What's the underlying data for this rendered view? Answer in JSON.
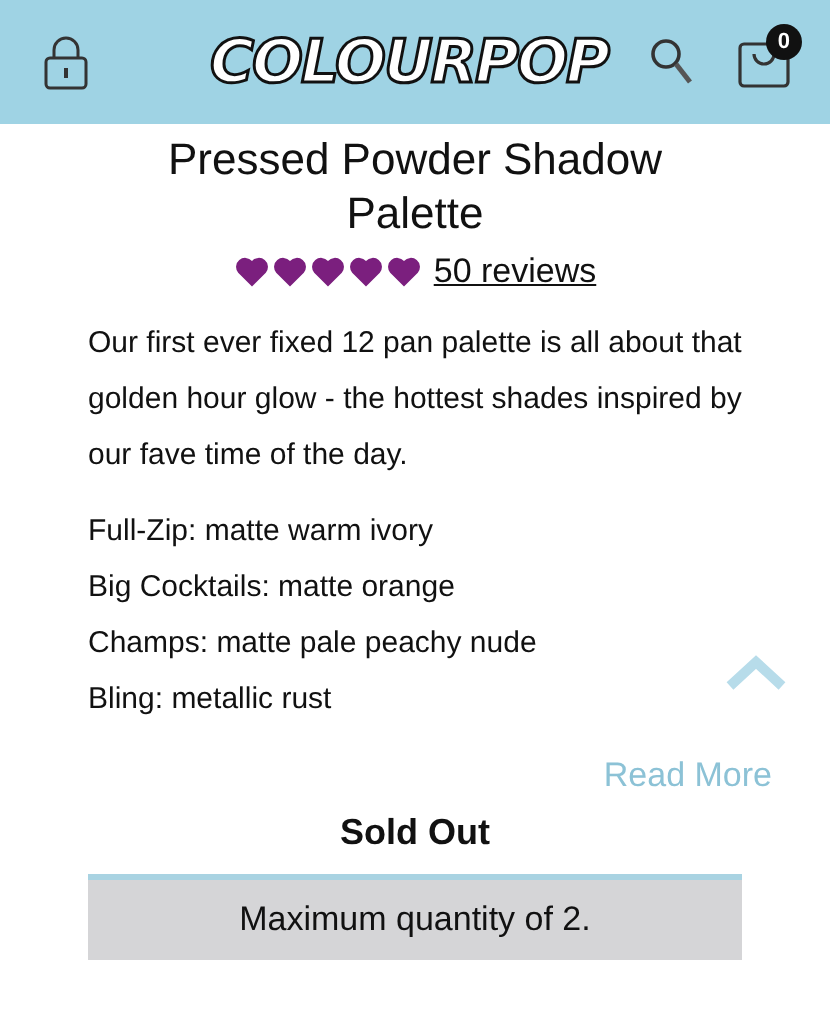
{
  "header": {
    "logo": "COLOURPOP",
    "cart_count": "0"
  },
  "product": {
    "title": "Pressed Powder Shadow Palette",
    "stars": 5,
    "reviews": "50 reviews",
    "description": "Our first ever fixed 12 pan palette is all about that golden hour glow - the hottest shades inspired by our fave time of the day.",
    "shades": [
      "Full-Zip: matte warm ivory",
      "Big Cocktails: matte orange",
      "Champs: matte pale peachy nude",
      "Bling: metallic rust"
    ],
    "read_more": "Read More",
    "status": "Sold Out",
    "notice": "Maximum quantity of 2."
  }
}
